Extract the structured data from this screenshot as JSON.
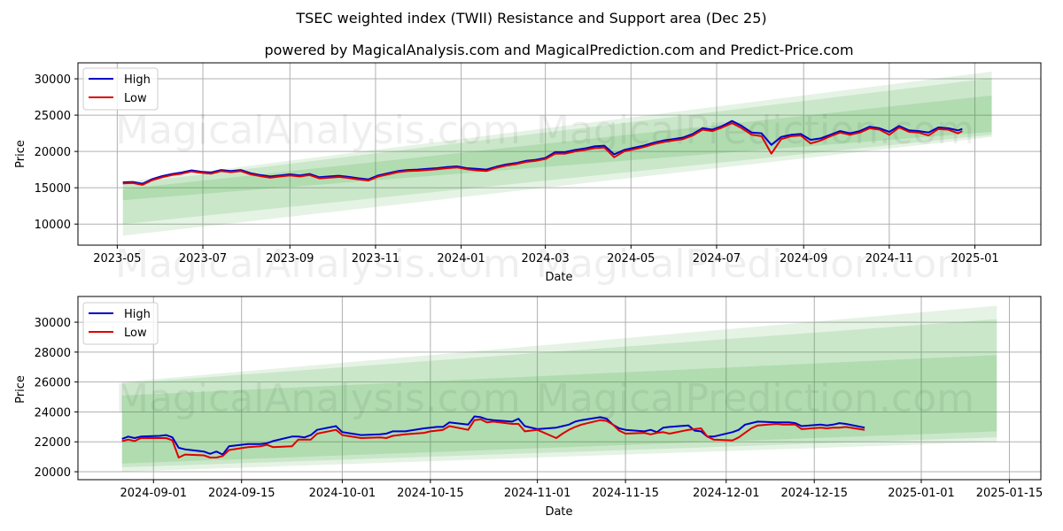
{
  "title": "TSEC weighted index (TWII) Resistance and Support area (Dec 25)",
  "subtitle": "powered by MagicalAnalysis.com and MagicalPrediction.com and Predict-Price.com",
  "watermarks": [
    "MagicalAnalysis.com",
    "MagicalPrediction.com"
  ],
  "colors": {
    "high": "#0000cc",
    "low": "#e00000",
    "band": "#2ca02c",
    "grid": "#b0b0b0"
  },
  "chart_data": [
    {
      "type": "line",
      "title": "",
      "xlabel": "Date",
      "ylabel": "Price",
      "xlim": [
        "2023-04-03",
        "2025-02-17"
      ],
      "ylim": [
        7100,
        32200
      ],
      "grid": true,
      "legend": {
        "placement": "top-left",
        "entries": [
          "High",
          "Low"
        ]
      },
      "xticks": [
        "2023-05",
        "2023-07",
        "2023-09",
        "2023-11",
        "2024-01",
        "2024-03",
        "2024-05",
        "2024-07",
        "2024-09",
        "2024-11",
        "2025-01"
      ],
      "xtick_dates": [
        "2023-05-01",
        "2023-07-01",
        "2023-09-01",
        "2023-11-01",
        "2024-01-01",
        "2024-03-01",
        "2024-05-01",
        "2024-07-01",
        "2024-09-01",
        "2024-11-01",
        "2025-01-01"
      ],
      "yticks": [
        10000,
        15000,
        20000,
        25000,
        30000
      ],
      "bands": [
        {
          "name": "outer-band",
          "x": [
            "2023-05-05",
            "2025-01-13"
          ],
          "upper": [
            15800,
            31000
          ],
          "lower": [
            8400,
            22000
          ],
          "opacity": 0.12
        },
        {
          "name": "middle-band",
          "x": [
            "2023-05-05",
            "2025-01-13"
          ],
          "upper": [
            15500,
            30100
          ],
          "lower": [
            10000,
            22300
          ],
          "opacity": 0.14
        },
        {
          "name": "inner-band",
          "x": [
            "2023-05-05",
            "2025-01-13"
          ],
          "upper": [
            14800,
            27700
          ],
          "lower": [
            13300,
            22700
          ],
          "opacity": 0.16
        }
      ],
      "x": [
        "2023-05-05",
        "2023-05-12",
        "2023-05-19",
        "2023-05-26",
        "2023-06-02",
        "2023-06-09",
        "2023-06-16",
        "2023-06-23",
        "2023-06-30",
        "2023-07-07",
        "2023-07-14",
        "2023-07-21",
        "2023-07-28",
        "2023-08-04",
        "2023-08-11",
        "2023-08-18",
        "2023-08-25",
        "2023-09-01",
        "2023-09-08",
        "2023-09-15",
        "2023-09-22",
        "2023-09-29",
        "2023-10-06",
        "2023-10-13",
        "2023-10-20",
        "2023-10-27",
        "2023-11-03",
        "2023-11-10",
        "2023-11-17",
        "2023-11-24",
        "2023-12-01",
        "2023-12-08",
        "2023-12-15",
        "2023-12-22",
        "2023-12-29",
        "2024-01-05",
        "2024-01-12",
        "2024-01-19",
        "2024-01-26",
        "2024-02-02",
        "2024-02-09",
        "2024-02-16",
        "2024-02-23",
        "2024-03-01",
        "2024-03-08",
        "2024-03-15",
        "2024-03-22",
        "2024-03-29",
        "2024-04-05",
        "2024-04-12",
        "2024-04-19",
        "2024-04-26",
        "2024-05-03",
        "2024-05-10",
        "2024-05-17",
        "2024-05-24",
        "2024-05-31",
        "2024-06-07",
        "2024-06-14",
        "2024-06-21",
        "2024-06-28",
        "2024-07-05",
        "2024-07-12",
        "2024-07-19",
        "2024-07-26",
        "2024-08-02",
        "2024-08-09",
        "2024-08-16",
        "2024-08-23",
        "2024-08-30",
        "2024-09-06",
        "2024-09-13",
        "2024-09-20",
        "2024-09-27",
        "2024-10-04",
        "2024-10-11",
        "2024-10-18",
        "2024-10-25",
        "2024-11-01",
        "2024-11-08",
        "2024-11-15",
        "2024-11-22",
        "2024-11-29",
        "2024-12-06",
        "2024-12-13",
        "2024-12-20",
        "2024-12-23"
      ],
      "series": [
        {
          "name": "High",
          "values": [
            15750,
            15800,
            15550,
            16200,
            16600,
            16900,
            17100,
            17400,
            17200,
            17100,
            17450,
            17300,
            17450,
            17000,
            16750,
            16550,
            16700,
            16850,
            16700,
            16900,
            16450,
            16550,
            16650,
            16500,
            16300,
            16150,
            16700,
            17000,
            17300,
            17450,
            17500,
            17600,
            17700,
            17850,
            17950,
            17700,
            17600,
            17500,
            17900,
            18200,
            18400,
            18700,
            18850,
            19100,
            19900,
            19900,
            20200,
            20400,
            20700,
            20800,
            19600,
            20200,
            20500,
            20800,
            21200,
            21500,
            21700,
            21900,
            22400,
            23200,
            23000,
            23500,
            24200,
            23500,
            22600,
            22500,
            20900,
            22000,
            22300,
            22400,
            21600,
            21800,
            22300,
            22800,
            22500,
            22800,
            23400,
            23200,
            22700,
            23500,
            22900,
            22800,
            22600,
            23300,
            23200,
            22900,
            23100
          ]
        },
        {
          "name": "Low",
          "values": [
            15600,
            15650,
            15400,
            16050,
            16450,
            16750,
            16950,
            17250,
            17050,
            16950,
            17300,
            17150,
            17300,
            16850,
            16600,
            16400,
            16550,
            16700,
            16550,
            16750,
            16300,
            16400,
            16500,
            16350,
            16150,
            16000,
            16550,
            16850,
            17150,
            17300,
            17350,
            17450,
            17550,
            17700,
            17800,
            17550,
            17400,
            17300,
            17750,
            18050,
            18250,
            18550,
            18700,
            18950,
            19700,
            19700,
            20000,
            20200,
            20450,
            20550,
            19200,
            20000,
            20300,
            20600,
            21000,
            21300,
            21500,
            21700,
            22200,
            23000,
            22800,
            23300,
            23900,
            23200,
            22300,
            22100,
            19700,
            21700,
            22100,
            22200,
            21100,
            21500,
            22100,
            22600,
            22300,
            22600,
            23200,
            23000,
            22300,
            23300,
            22700,
            22600,
            22200,
            23100,
            23000,
            22500,
            22800
          ]
        }
      ]
    },
    {
      "type": "line",
      "title": "",
      "xlabel": "Date",
      "ylabel": "Price",
      "xlim": [
        "2024-08-20",
        "2025-01-20"
      ],
      "ylim": [
        19470,
        31720
      ],
      "grid": true,
      "legend": {
        "placement": "top-left",
        "entries": [
          "High",
          "Low"
        ]
      },
      "xticks": [
        "2024-09-01",
        "2024-09-15",
        "2024-10-01",
        "2024-10-15",
        "2024-11-01",
        "2024-11-15",
        "2024-12-01",
        "2024-12-15",
        "2025-01-01",
        "2025-01-15"
      ],
      "yticks": [
        20000,
        22000,
        24000,
        26000,
        28000,
        30000
      ],
      "bands": [
        {
          "name": "outer-band",
          "x": [
            "2024-08-27",
            "2025-01-13"
          ],
          "upper": [
            26000,
            31100
          ],
          "lower": [
            20000,
            22000
          ],
          "opacity": 0.12
        },
        {
          "name": "middle-band",
          "x": [
            "2024-08-27",
            "2025-01-13"
          ],
          "upper": [
            25900,
            30200
          ],
          "lower": [
            20300,
            22300
          ],
          "opacity": 0.14
        },
        {
          "name": "inner-band",
          "x": [
            "2024-08-27",
            "2025-01-13"
          ],
          "upper": [
            25100,
            27800
          ],
          "lower": [
            20550,
            22700
          ],
          "opacity": 0.16
        }
      ],
      "x": [
        "2024-08-27",
        "2024-08-28",
        "2024-08-29",
        "2024-08-30",
        "2024-09-02",
        "2024-09-03",
        "2024-09-04",
        "2024-09-05",
        "2024-09-06",
        "2024-09-09",
        "2024-09-10",
        "2024-09-11",
        "2024-09-12",
        "2024-09-13",
        "2024-09-16",
        "2024-09-18",
        "2024-09-19",
        "2024-09-20",
        "2024-09-23",
        "2024-09-24",
        "2024-09-25",
        "2024-09-26",
        "2024-09-27",
        "2024-09-30",
        "2024-10-01",
        "2024-10-04",
        "2024-10-07",
        "2024-10-08",
        "2024-10-09",
        "2024-10-11",
        "2024-10-14",
        "2024-10-15",
        "2024-10-16",
        "2024-10-17",
        "2024-10-18",
        "2024-10-21",
        "2024-10-22",
        "2024-10-23",
        "2024-10-24",
        "2024-10-25",
        "2024-10-28",
        "2024-10-29",
        "2024-10-30",
        "2024-11-01",
        "2024-11-04",
        "2024-11-05",
        "2024-11-06",
        "2024-11-07",
        "2024-11-08",
        "2024-11-11",
        "2024-11-12",
        "2024-11-13",
        "2024-11-14",
        "2024-11-15",
        "2024-11-18",
        "2024-11-19",
        "2024-11-20",
        "2024-11-21",
        "2024-11-22",
        "2024-11-25",
        "2024-11-26",
        "2024-11-27",
        "2024-11-28",
        "2024-11-29",
        "2024-12-02",
        "2024-12-03",
        "2024-12-04",
        "2024-12-05",
        "2024-12-06",
        "2024-12-09",
        "2024-12-10",
        "2024-12-11",
        "2024-12-12",
        "2024-12-13",
        "2024-12-16",
        "2024-12-17",
        "2024-12-18",
        "2024-12-19",
        "2024-12-20",
        "2024-12-23"
      ],
      "series": [
        {
          "name": "High",
          "values": [
            22200,
            22350,
            22250,
            22350,
            22400,
            22450,
            22300,
            21600,
            21500,
            21350,
            21200,
            21350,
            21150,
            21700,
            21850,
            21850,
            21900,
            22050,
            22350,
            22350,
            22300,
            22450,
            22800,
            23050,
            22650,
            22450,
            22500,
            22550,
            22700,
            22700,
            22900,
            22950,
            23000,
            23000,
            23300,
            23150,
            23700,
            23650,
            23500,
            23450,
            23350,
            23550,
            23050,
            22850,
            22950,
            23050,
            23150,
            23350,
            23450,
            23650,
            23550,
            23150,
            22900,
            22800,
            22700,
            22800,
            22650,
            22950,
            23000,
            23100,
            22750,
            22700,
            22350,
            22350,
            22650,
            22800,
            23150,
            23250,
            23350,
            23300,
            23300,
            23300,
            23250,
            23050,
            23150,
            23100,
            23150,
            23250,
            23200,
            22950,
            22850,
            23100
          ]
        },
        {
          "name": "Low",
          "values": [
            22050,
            22150,
            22050,
            22250,
            22250,
            22250,
            22100,
            20950,
            21150,
            21100,
            20950,
            20950,
            21050,
            21450,
            21650,
            21700,
            21800,
            21650,
            21700,
            22150,
            22150,
            22150,
            22550,
            22800,
            22450,
            22250,
            22300,
            22250,
            22400,
            22500,
            22600,
            22700,
            22750,
            22800,
            23050,
            22800,
            23450,
            23500,
            23300,
            23350,
            23200,
            23200,
            22700,
            22800,
            22250,
            22550,
            22800,
            23000,
            23150,
            23450,
            23400,
            23150,
            22750,
            22550,
            22600,
            22500,
            22600,
            22650,
            22550,
            22800,
            22850,
            22900,
            22350,
            22150,
            22100,
            22300,
            22600,
            22900,
            23100,
            23200,
            23150,
            23150,
            23150,
            22850,
            22950,
            22900,
            22950,
            22950,
            23000,
            22800,
            22550,
            22750
          ]
        }
      ]
    }
  ]
}
